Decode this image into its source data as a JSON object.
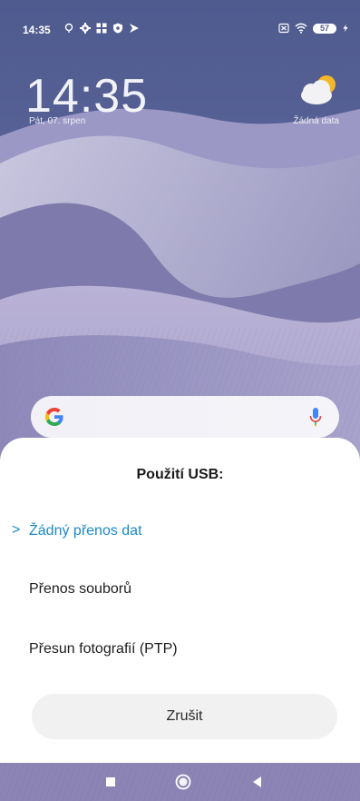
{
  "status_bar": {
    "time": "14:35",
    "battery_level": "57",
    "left_icons": [
      "location-icon",
      "settings-icon",
      "apps-icon",
      "shield-icon",
      "media-icon"
    ],
    "right_icons": [
      "sim-icon",
      "wifi-icon",
      "battery-icon",
      "charging-icon"
    ]
  },
  "lockscreen": {
    "clock": "14:35",
    "date": "Pát, 07. srpen",
    "weather_text": "Žádná data",
    "weather_icon": "cloud-sun-icon"
  },
  "search_bar": {
    "logo": "google-logo",
    "mic_icon": "microphone-icon"
  },
  "usb_dialog": {
    "title": "Použití USB:",
    "options": [
      {
        "label": "Žádný přenos dat",
        "selected": true
      },
      {
        "label": "Přenos souborů",
        "selected": false
      },
      {
        "label": "Přesun fotografií (PTP)",
        "selected": false
      }
    ],
    "selected_marker": ">",
    "cancel_label": "Zrušit"
  },
  "nav_bar": {
    "buttons": [
      "recents-icon",
      "home-icon",
      "back-icon"
    ]
  },
  "colors": {
    "accent": "#1b8ac8",
    "sheet_bg": "#ffffff",
    "cancel_bg": "#f1f1f1"
  }
}
